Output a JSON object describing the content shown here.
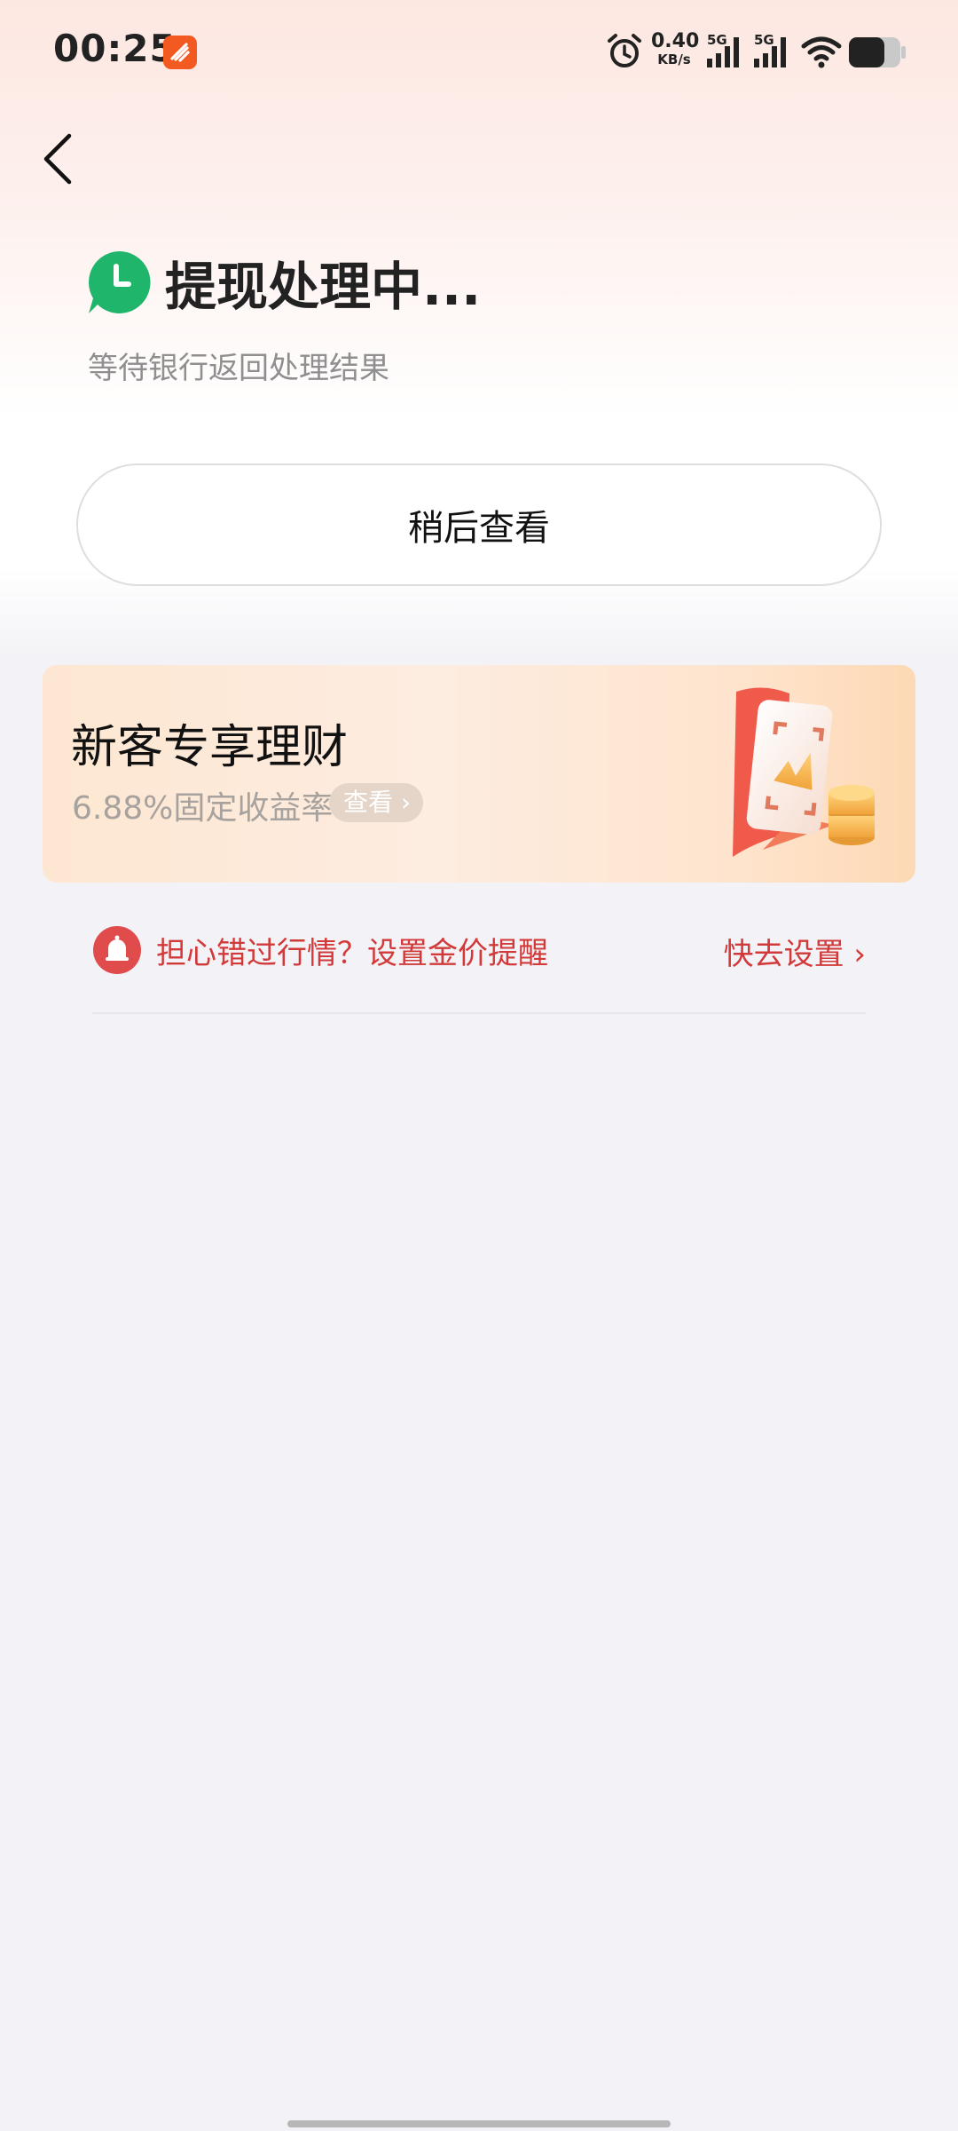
{
  "status_bar": {
    "time": "00:25",
    "network_speed_value": "0.40",
    "network_speed_unit": "KB/s",
    "signal_1_label": "5G",
    "signal_2_label": "5G",
    "icons": [
      "app-notification-icon",
      "alarm-icon",
      "signal-icon",
      "signal-icon",
      "wifi-icon",
      "battery-icon"
    ]
  },
  "header": {
    "back_icon": "chevron-left-icon"
  },
  "status": {
    "icon": "clock-icon",
    "icon_color": "#1fb56b",
    "title": "提现处理中...",
    "subtitle": "等待银行返回处理结果"
  },
  "actions": {
    "later_label": "稍后查看"
  },
  "promo": {
    "title": "新客专享理财",
    "rate_text": "6.88%固定收益率",
    "view_label": "查看",
    "view_chevron": "›"
  },
  "alert": {
    "icon": "bell-icon",
    "text": "担心错过行情？设置金价提醒",
    "action_label": "快去设置 ›",
    "accent_color": "#d23a3a"
  }
}
